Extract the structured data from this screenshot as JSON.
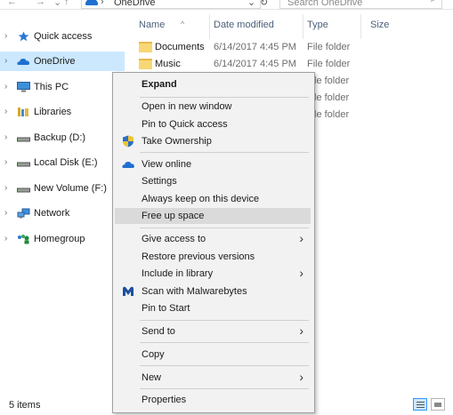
{
  "address": {
    "location": "OneDrive"
  },
  "search": {
    "placeholder": "Search OneDrive"
  },
  "nav": {
    "items": [
      {
        "label": "Quick access",
        "icon": "star-icon"
      },
      {
        "label": "OneDrive",
        "icon": "cloud-icon",
        "selected": true
      },
      {
        "label": "This PC",
        "icon": "monitor-icon"
      },
      {
        "label": "Libraries",
        "icon": "libraries-icon"
      },
      {
        "label": "Backup (D:)",
        "icon": "drive-icon"
      },
      {
        "label": "Local Disk (E:)",
        "icon": "drive-icon"
      },
      {
        "label": "New Volume (F:)",
        "icon": "drive-icon"
      },
      {
        "label": "Network",
        "icon": "network-icon"
      },
      {
        "label": "Homegroup",
        "icon": "homegroup-icon"
      }
    ]
  },
  "columns": {
    "name": "Name",
    "date": "Date modified",
    "type": "Type",
    "size": "Size"
  },
  "files": [
    {
      "name": "Documents",
      "date": "6/14/2017 4:45 PM",
      "type": "File folder"
    },
    {
      "name": "Music",
      "date": "6/14/2017 4:45 PM",
      "type": "File folder"
    },
    {
      "name": "",
      "date": "",
      "type": "le folder"
    },
    {
      "name": "",
      "date": "",
      "type": "le folder"
    },
    {
      "name": "",
      "date": "",
      "type": "le folder"
    }
  ],
  "status": {
    "count": "5 items"
  },
  "context_menu": {
    "items": {
      "expand": "Expand",
      "open_new_window": "Open in new window",
      "pin_quick_access": "Pin to Quick access",
      "take_ownership": "Take Ownership",
      "view_online": "View online",
      "settings": "Settings",
      "always_keep": "Always keep on this device",
      "free_up_space": "Free up space",
      "give_access": "Give access to",
      "restore_versions": "Restore previous versions",
      "include_library": "Include in library",
      "scan_malwarebytes": "Scan with Malwarebytes",
      "pin_start": "Pin to Start",
      "send_to": "Send to",
      "copy": "Copy",
      "new": "New",
      "properties": "Properties"
    },
    "highlighted": "free_up_space"
  },
  "colors": {
    "selection": "#cce8ff",
    "menu_bg": "#f2f2f2",
    "menu_highlight": "#dadada",
    "onedrive_blue": "#1e6fd0"
  }
}
